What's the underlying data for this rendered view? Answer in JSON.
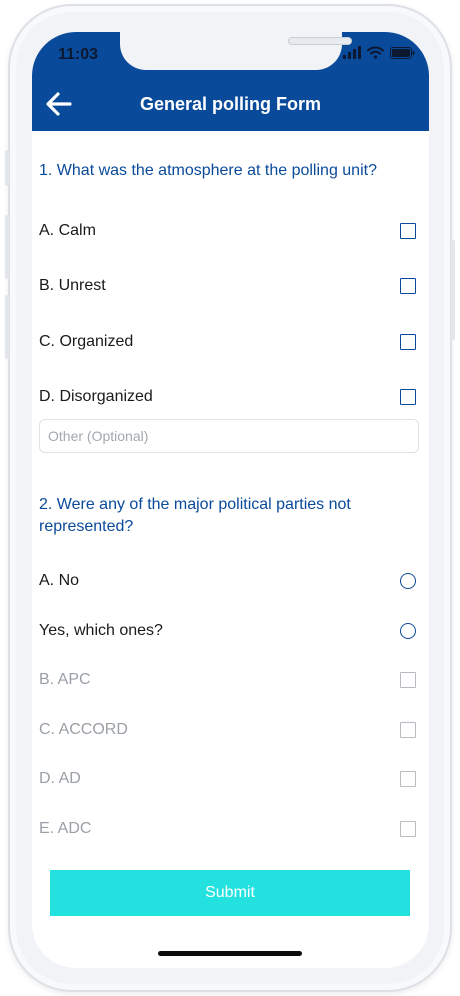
{
  "status_bar": {
    "time": "11:03"
  },
  "header": {
    "title": "General polling Form"
  },
  "question1": {
    "text": "1. What was the atmosphere at the polling unit?",
    "options": [
      "A. Calm",
      "B. Unrest",
      "C. Organized",
      "D. Disorganized"
    ],
    "other_placeholder": "Other (Optional)"
  },
  "question2": {
    "text": "2. Were any of the major political parties not represented?",
    "options": [
      "A. No",
      "Yes, which ones?"
    ],
    "parties": [
      "B. APC",
      "C. ACCORD",
      "D. AD",
      "E. ADC"
    ]
  },
  "submit_label": "Submit",
  "colors": {
    "header": "#0a4a9a",
    "accent": "#0a4a9a",
    "submit": "#22e1de"
  }
}
